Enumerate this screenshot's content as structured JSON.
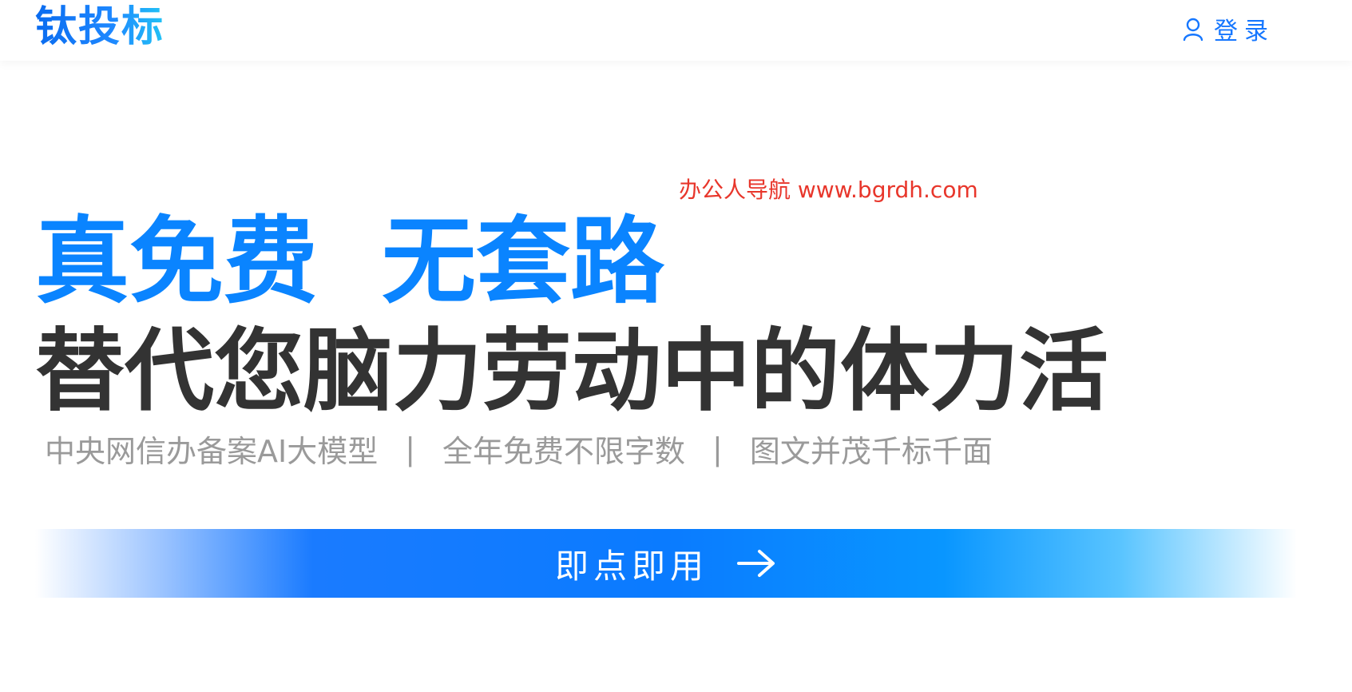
{
  "header": {
    "logo_text": "钛投标",
    "login_label": "登录",
    "icons": {
      "login": "user-icon"
    }
  },
  "watermark": "办公人导航 www.bgrdh.com",
  "hero": {
    "headline_part1": "真免费",
    "headline_part2": "无套路",
    "subheadline": "替代您脑力劳动中的体力活",
    "features": [
      "中央网信办备案AI大模型",
      "全年免费不限字数",
      "图文并茂千标千面"
    ],
    "separator": "|"
  },
  "cta": {
    "label": "即点即用",
    "icon": "arrow-right-icon"
  },
  "colors": {
    "brand_blue": "#0a84ff",
    "dark_text": "#333333",
    "muted_text": "#9a9a9a",
    "watermark_red": "#e8362b"
  }
}
